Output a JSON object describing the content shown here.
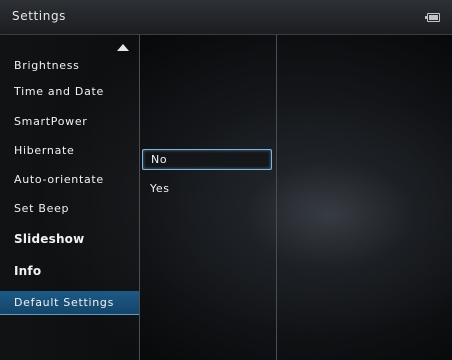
{
  "titlebar": {
    "title": "Settings",
    "battery_icon": "battery-icon"
  },
  "menu": {
    "scroll_icon": "scroll-up-arrow-icon",
    "items": [
      {
        "label": "Brightness"
      },
      {
        "label": "Time and Date"
      },
      {
        "label": "SmartPower"
      },
      {
        "label": "Hibernate"
      },
      {
        "label": "Auto-orientate"
      },
      {
        "label": "Set Beep"
      },
      {
        "label": "Slideshow"
      },
      {
        "label": "Info"
      },
      {
        "label": "Default Settings",
        "selected": true
      }
    ]
  },
  "options": {
    "items": [
      {
        "label": "No",
        "focused": true
      },
      {
        "label": "Yes"
      }
    ]
  },
  "colors": {
    "selected_bg": "#1d5a86",
    "focus_border": "#7fb4df"
  }
}
